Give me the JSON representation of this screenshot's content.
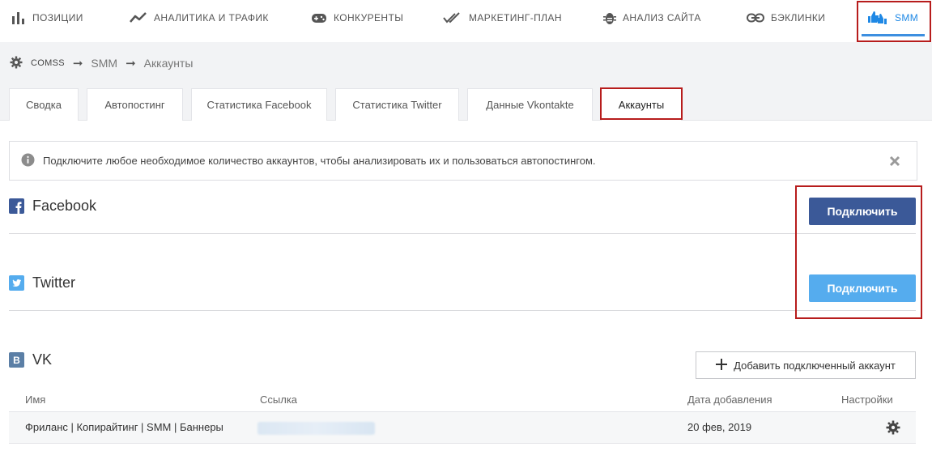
{
  "topnav": {
    "items": [
      {
        "label": "ПОЗИЦИИ",
        "icon": "bar-chart-icon"
      },
      {
        "label": "АНАЛИТИКА И ТРАФИК",
        "icon": "trend-line-icon"
      },
      {
        "label": "КОНКУРЕНТЫ",
        "icon": "gamepad-icon"
      },
      {
        "label": "МАРКЕТИНГ-ПЛАН",
        "icon": "double-check-icon"
      },
      {
        "label": "АНАЛИЗ САЙТА",
        "icon": "bug-icon"
      },
      {
        "label": "БЭКЛИНКИ",
        "icon": "link-icon"
      },
      {
        "label": "SMM",
        "icon": "thumbs-icon",
        "active": true
      }
    ]
  },
  "breadcrumb": {
    "root": "COMSS",
    "items": [
      "SMM",
      "Аккаунты"
    ]
  },
  "tabs": [
    {
      "label": "Сводка"
    },
    {
      "label": "Автопостинг"
    },
    {
      "label": "Статистика Facebook"
    },
    {
      "label": "Статистика Twitter"
    },
    {
      "label": "Данные Vkontakte"
    },
    {
      "label": "Аккаунты",
      "active": true
    }
  ],
  "alert": {
    "text": "Подключите любое необходимое количество аккаунтов, чтобы анализировать их и пользоваться автопостингом."
  },
  "sections": {
    "facebook": {
      "title": "Facebook",
      "button": "Подключить"
    },
    "twitter": {
      "title": "Twitter",
      "button": "Подключить"
    },
    "vk": {
      "title": "VK",
      "add_button": "Добавить подключенный аккаунт",
      "columns": [
        "Имя",
        "Ссылка",
        "Дата добавления",
        "Настройки"
      ],
      "rows": [
        {
          "name": "Фриланс | Копирайтинг | SMM | Баннеры",
          "date": "20 фев, 2019"
        }
      ]
    }
  },
  "colors": {
    "accent": "#1e88e5",
    "facebook": "#3b5998",
    "twitter": "#55acee",
    "vk": "#5b7fa6",
    "highlight_box": "#b71c1c"
  }
}
